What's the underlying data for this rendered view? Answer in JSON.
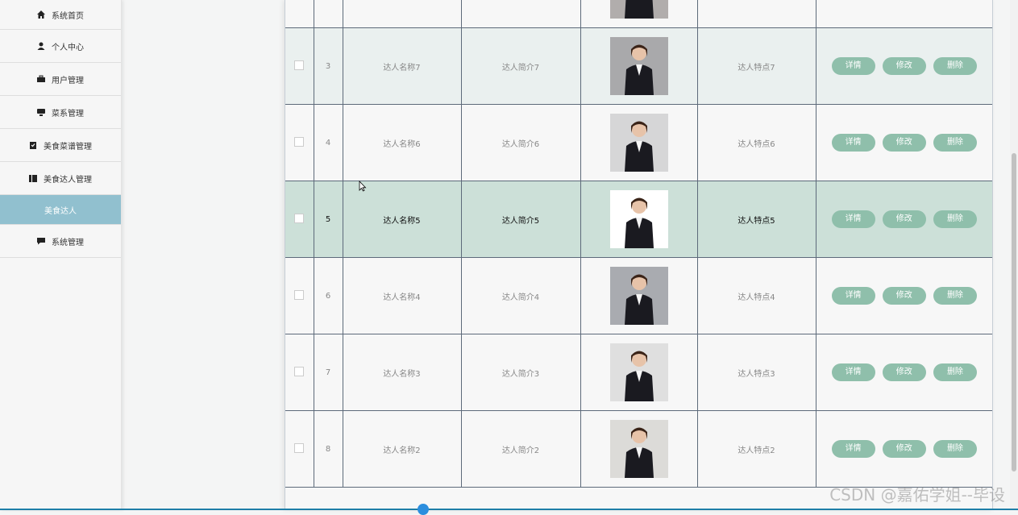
{
  "sidebar": {
    "items": [
      {
        "label": "系统首页",
        "icon": "home-icon"
      },
      {
        "label": "个人中心",
        "icon": "user-icon"
      },
      {
        "label": "用户管理",
        "icon": "briefcase-icon"
      },
      {
        "label": "菜系管理",
        "icon": "tray-icon"
      },
      {
        "label": "美食菜谱管理",
        "icon": "clipboard-icon"
      },
      {
        "label": "美食达人管理",
        "icon": "book-icon"
      },
      {
        "label": "美食达人",
        "icon": ""
      },
      {
        "label": "系统管理",
        "icon": "chat-icon"
      }
    ],
    "active_index": 6
  },
  "table": {
    "actions": {
      "detail": "详情",
      "edit": "修改",
      "delete": "删除"
    },
    "rows": [
      {
        "index": "",
        "name": "",
        "intro": "",
        "feature": ""
      },
      {
        "index": "3",
        "name": "达人名称7",
        "intro": "达人简介7",
        "feature": "达人特点7"
      },
      {
        "index": "4",
        "name": "达人名称6",
        "intro": "达人简介6",
        "feature": "达人特点6"
      },
      {
        "index": "5",
        "name": "达人名称5",
        "intro": "达人简介5",
        "feature": "达人特点5"
      },
      {
        "index": "6",
        "name": "达人名称4",
        "intro": "达人简介4",
        "feature": "达人特点4"
      },
      {
        "index": "7",
        "name": "达人名称3",
        "intro": "达人简介3",
        "feature": "达人特点3"
      },
      {
        "index": "8",
        "name": "达人名称2",
        "intro": "达人简介2",
        "feature": "达人特点2"
      }
    ]
  },
  "watermark": "CSDN @嘉佑学姐--毕设",
  "colors": {
    "accent": "#91c0cf",
    "button": "#8fbfab",
    "highlight_row": "#cce0d8"
  }
}
